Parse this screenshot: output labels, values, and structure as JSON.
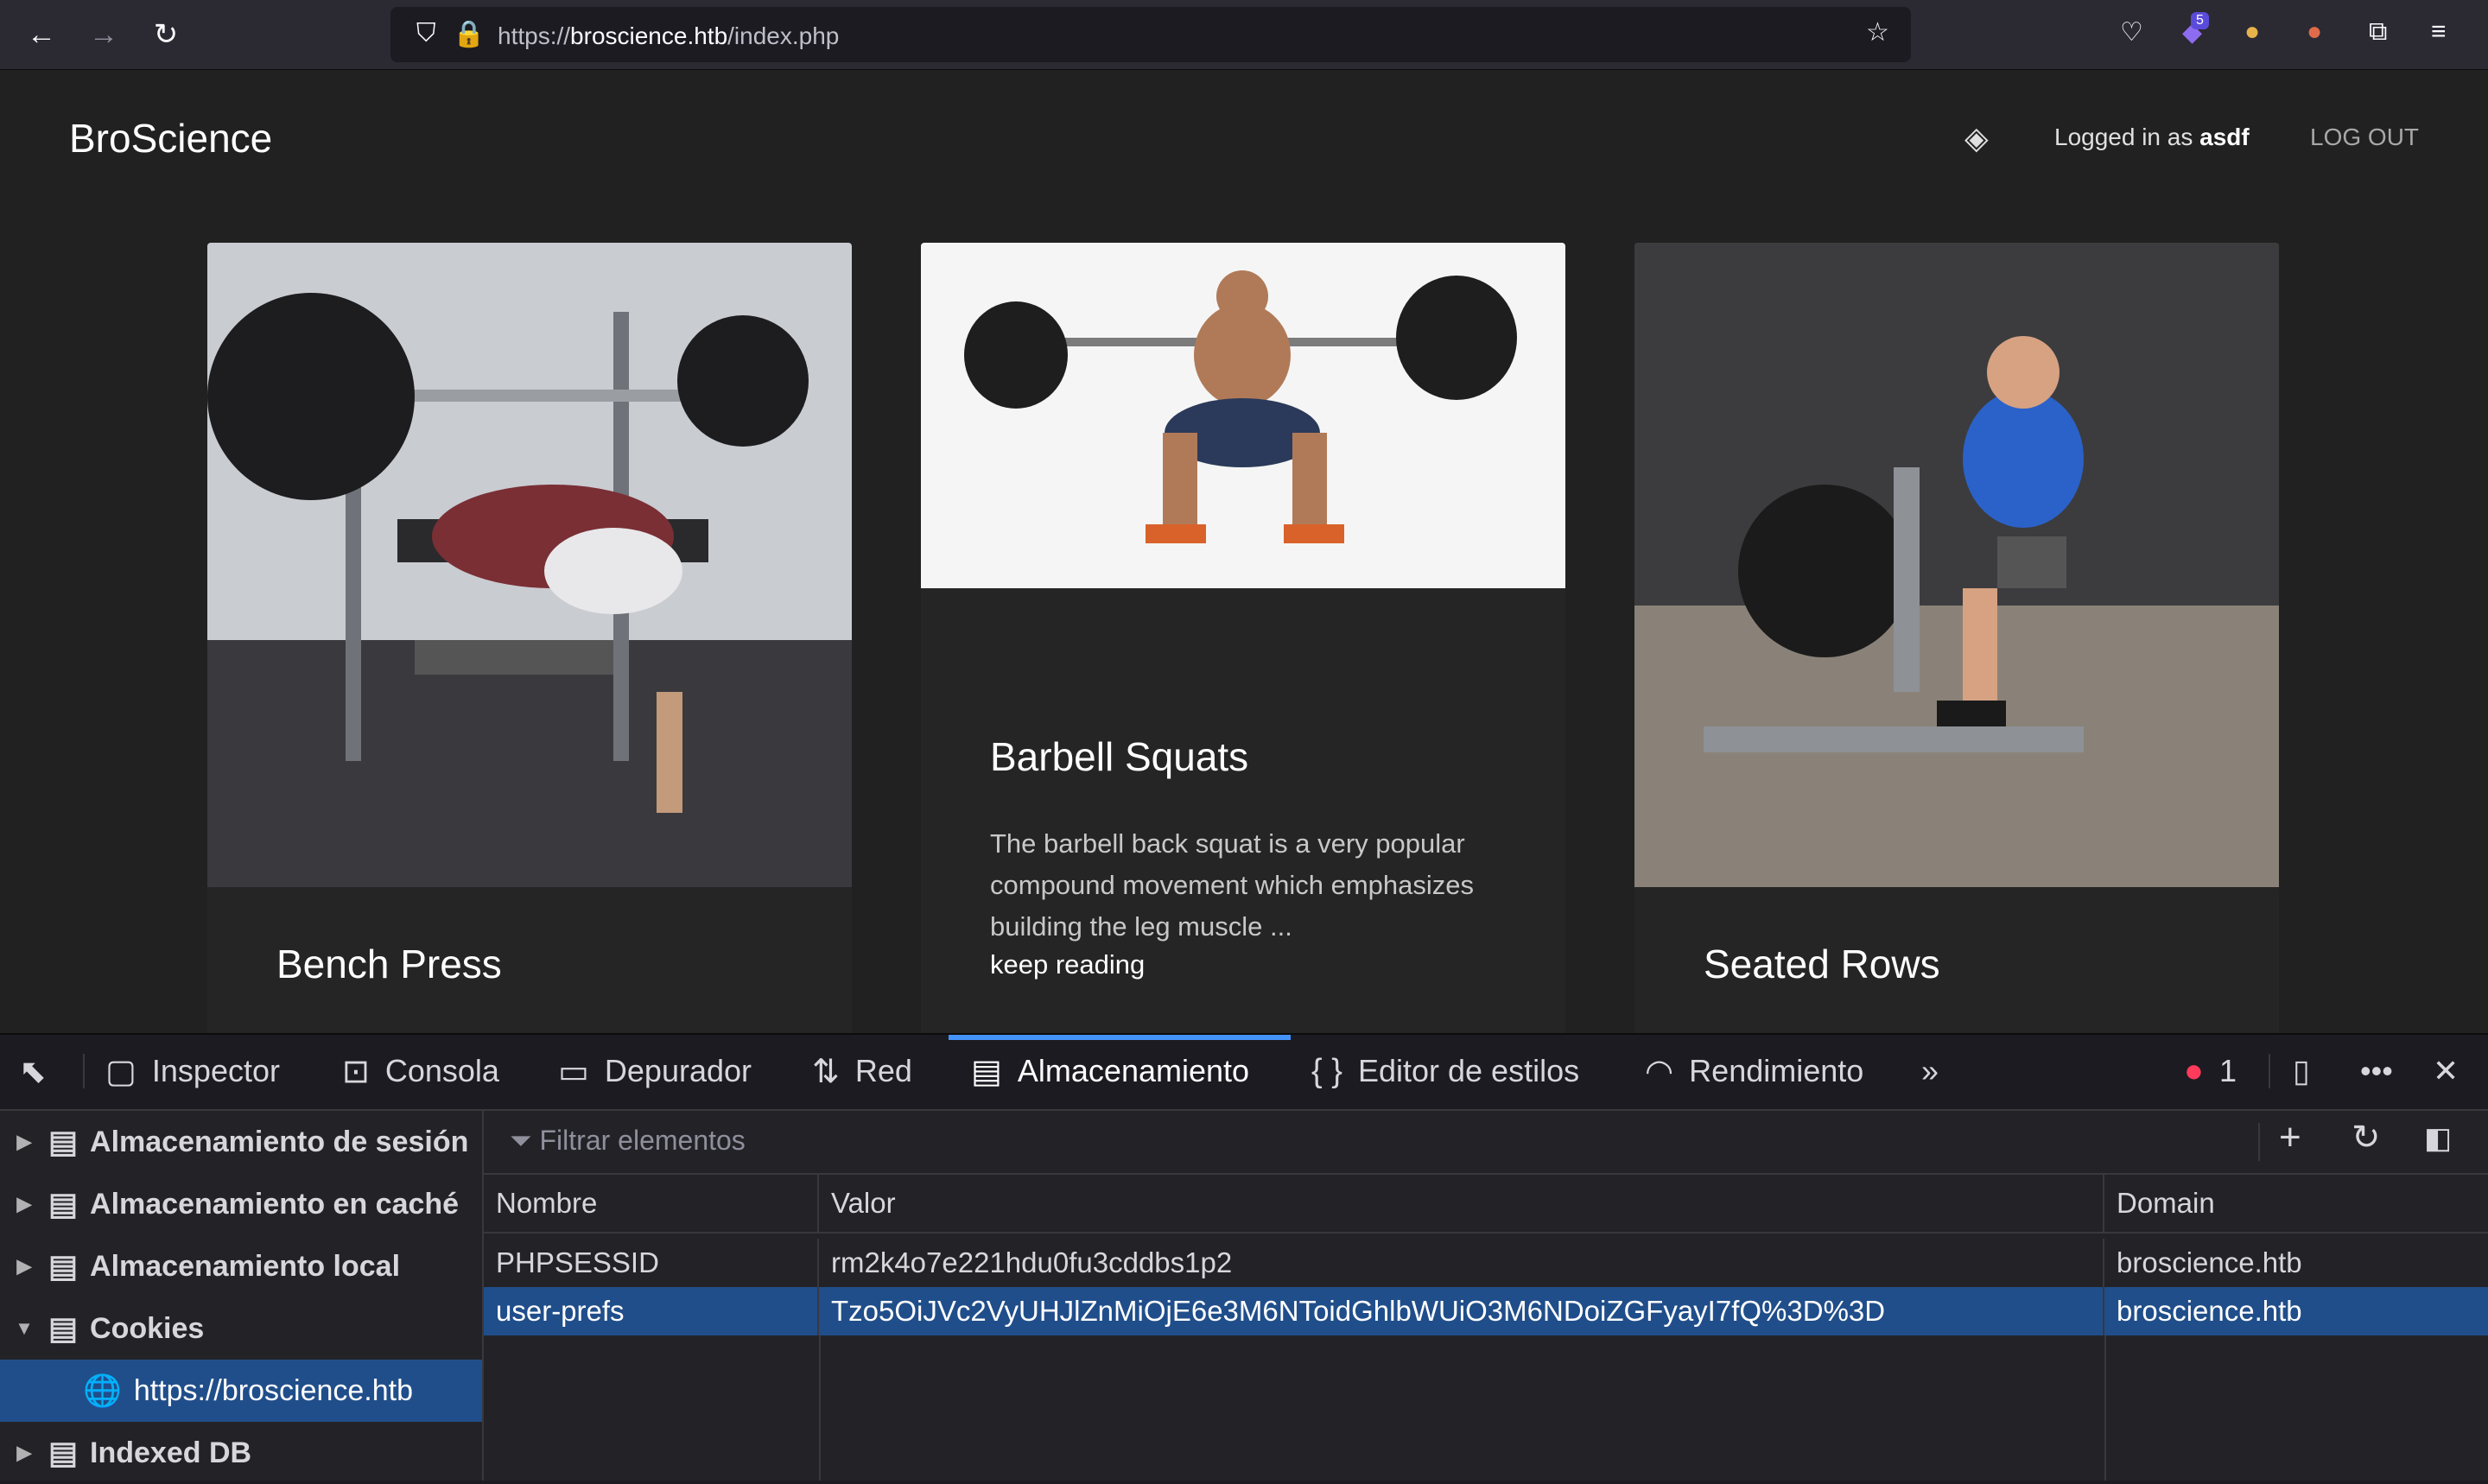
{
  "browser": {
    "url_prefix": "https://",
    "url_host": "broscience.htb",
    "url_path": "/index.php",
    "badge_count": "5"
  },
  "site": {
    "brand": "BroScience",
    "logged_in_prefix": "Logged in as",
    "username": "asdf",
    "logout_label": "LOG OUT"
  },
  "cards": [
    {
      "title": "Bench Press"
    },
    {
      "title": "Barbell Squats",
      "text": "The barbell back squat is a very popular compound movement which emphasizes building the leg muscle ...",
      "link": "keep reading"
    },
    {
      "title": "Seated Rows"
    }
  ],
  "devtools": {
    "tabs": [
      "Inspector",
      "Consola",
      "Depurador",
      "Red",
      "Almacenamiento",
      "Editor de estilos",
      "Rendimiento"
    ],
    "active_tab": "Almacenamiento",
    "error_count": "1",
    "sidebar": [
      "Almacenamiento de sesión",
      "Almacenamiento en caché",
      "Almacenamiento local",
      "Cookies",
      "https://broscience.htb",
      "Indexed DB"
    ],
    "filter_placeholder": "Filtrar elementos",
    "columns": [
      "Nombre",
      "Valor",
      "Domain"
    ],
    "rows": [
      {
        "name": "PHPSESSID",
        "value": "rm2k4o7e221hdu0fu3cddbs1p2",
        "domain": "broscience.htb"
      },
      {
        "name": "user-prefs",
        "value": "Tzo5OiJVc2VyUHJlZnMiOjE6e3M6NToidGhlbWUiO3M6NDoiZGFyayI7fQ%3D%3D",
        "domain": "broscience.htb"
      }
    ]
  }
}
